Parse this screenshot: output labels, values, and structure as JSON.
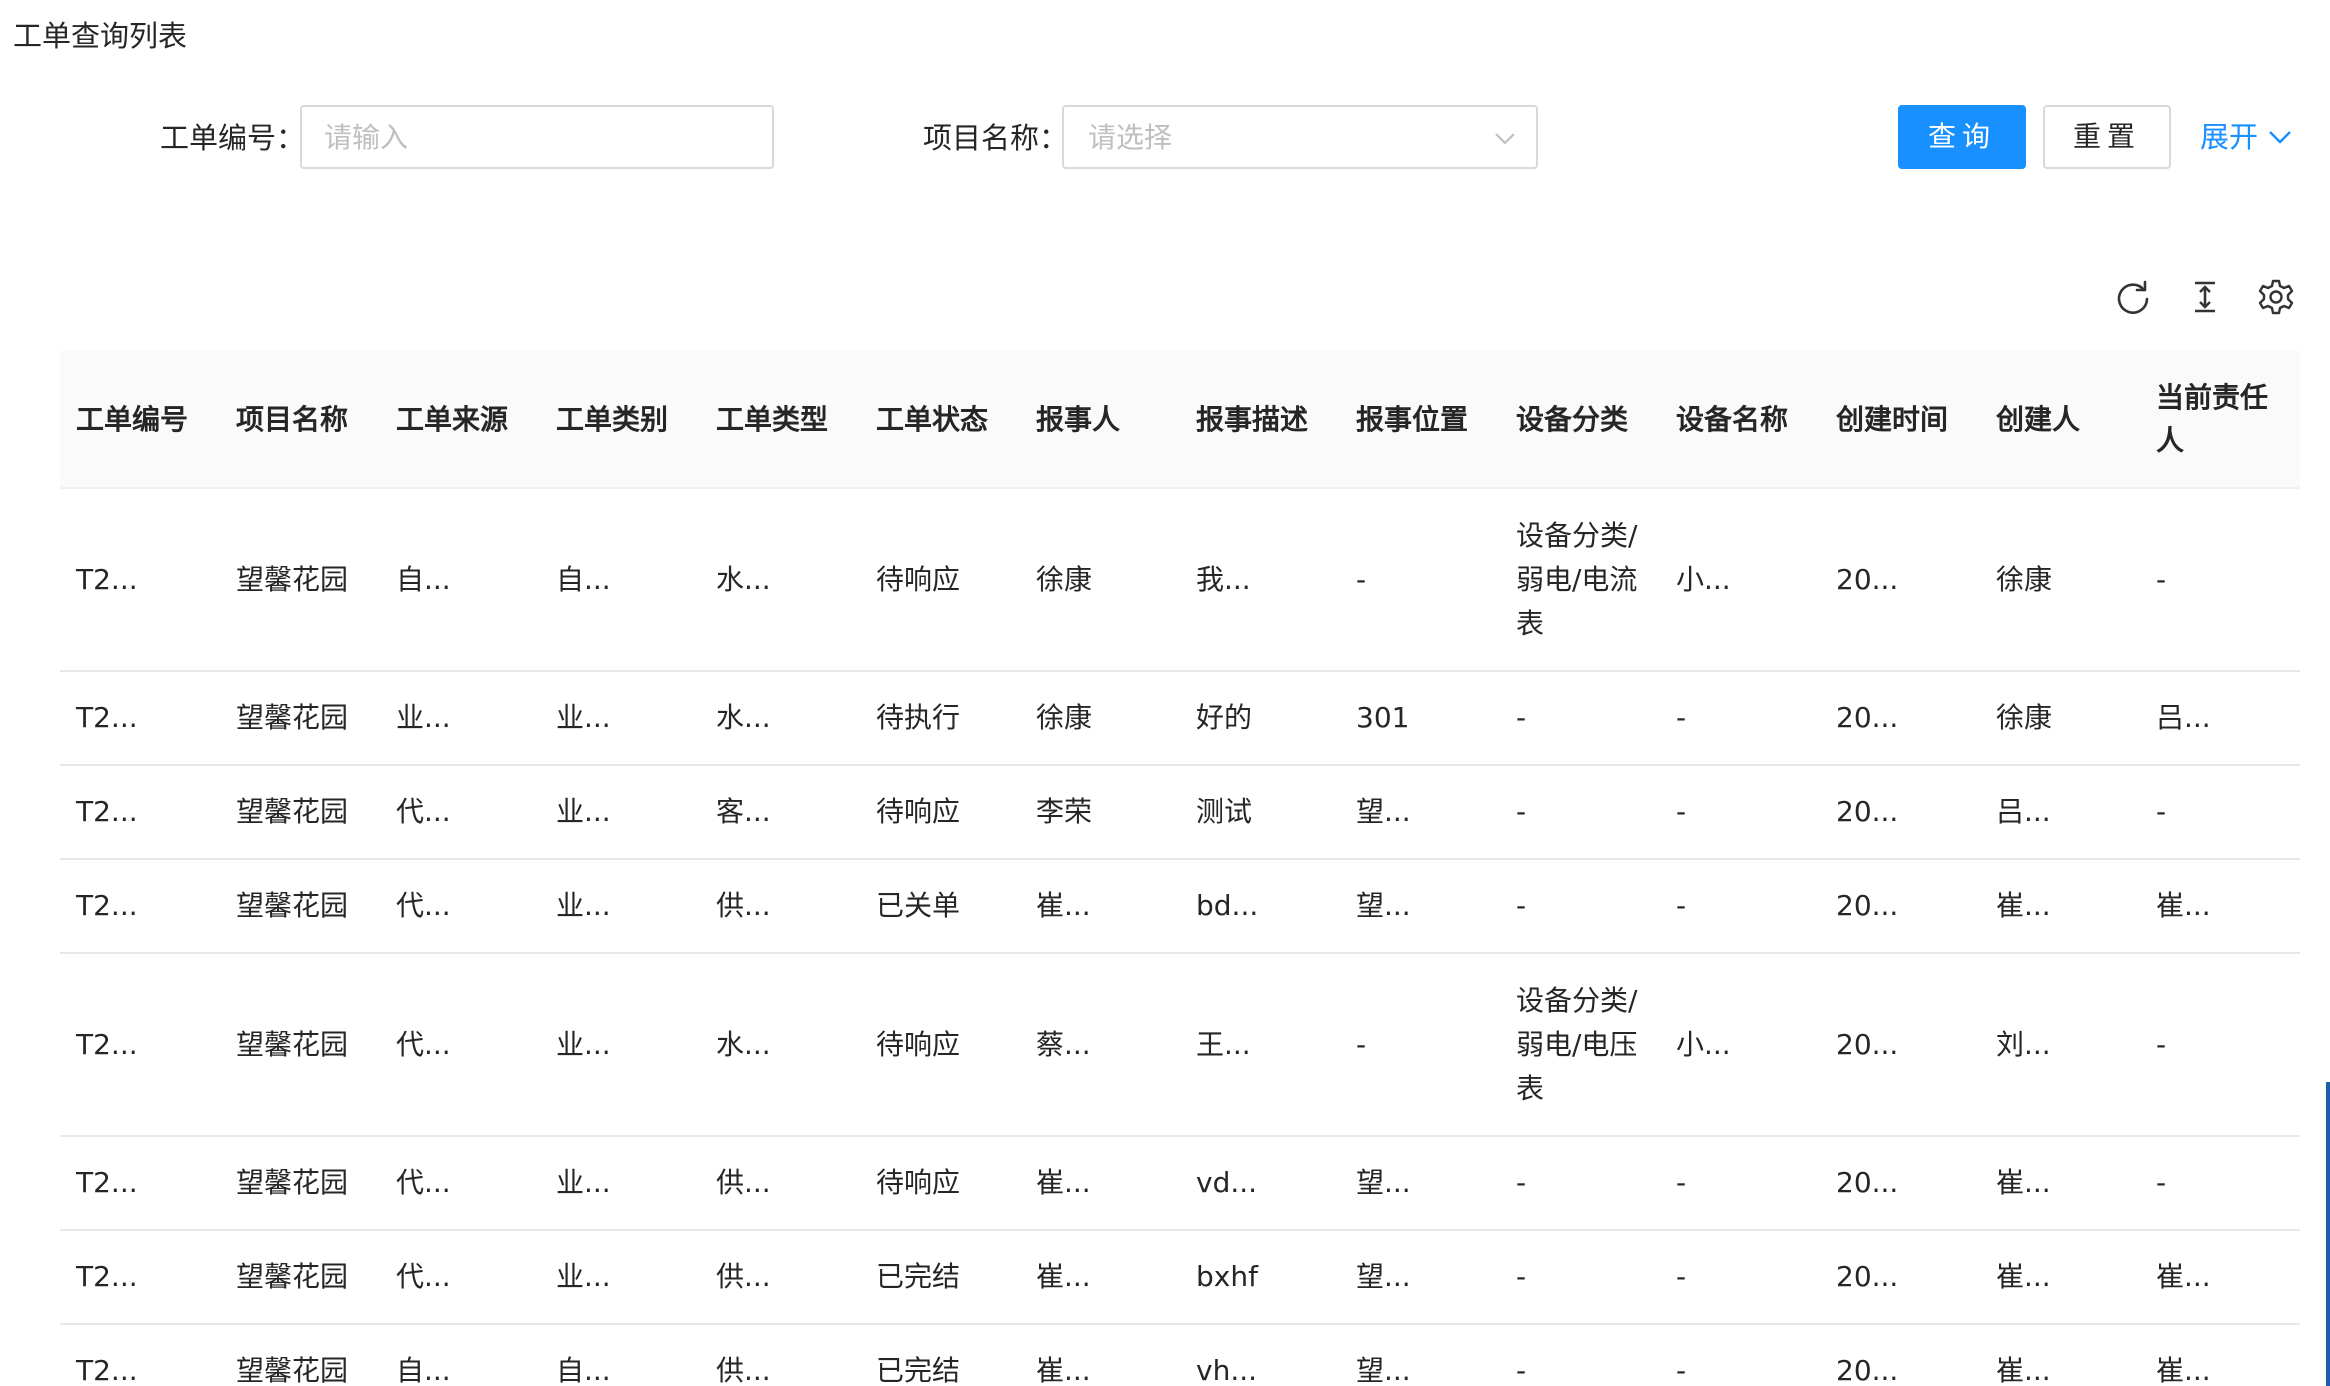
{
  "page": {
    "title": "工单查询列表"
  },
  "search": {
    "order_no_label": "工单编号：",
    "order_no_placeholder": "请输入",
    "project_label": "项目名称：",
    "project_placeholder": "请选择",
    "query_label": "查询",
    "reset_label": "重置",
    "expand_label": "展开"
  },
  "toolbar": {
    "icons": [
      "refresh-icon",
      "column-height-icon",
      "settings-icon"
    ]
  },
  "colors": {
    "primary": "#1890ff",
    "border": "#d9d9d9",
    "header_bg": "#fafafa",
    "placeholder": "#bfbfbf"
  },
  "table": {
    "columns": [
      "工单编号",
      "项目名称",
      "工单来源",
      "工单类别",
      "工单类型",
      "工单状态",
      "报事人",
      "报事描述",
      "报事位置",
      "设备分类",
      "设备名称",
      "创建时间",
      "创建人",
      "当前责任人"
    ],
    "rows": [
      [
        "T2...",
        "望馨花园",
        "自...",
        "自...",
        "水...",
        "待响应",
        "徐康",
        "我...",
        "-",
        "设备分类/弱电/电流表",
        "小...",
        "20...",
        "徐康",
        "-"
      ],
      [
        "T2...",
        "望馨花园",
        "业...",
        "业...",
        "水...",
        "待执行",
        "徐康",
        "好的",
        "301",
        "-",
        "-",
        "20...",
        "徐康",
        "吕..."
      ],
      [
        "T2...",
        "望馨花园",
        "代...",
        "业...",
        "客...",
        "待响应",
        "李荣",
        "测试",
        "望...",
        "-",
        "-",
        "20...",
        "吕...",
        "-"
      ],
      [
        "T2...",
        "望馨花园",
        "代...",
        "业...",
        "供...",
        "已关单",
        "崔...",
        "bd...",
        "望...",
        "-",
        "-",
        "20...",
        "崔...",
        "崔..."
      ],
      [
        "T2...",
        "望馨花园",
        "代...",
        "业...",
        "水...",
        "待响应",
        "蔡...",
        "王...",
        "-",
        "设备分类/弱电/电压表",
        "小...",
        "20...",
        "刘...",
        "-"
      ],
      [
        "T2...",
        "望馨花园",
        "代...",
        "业...",
        "供...",
        "待响应",
        "崔...",
        "vd...",
        "望...",
        "-",
        "-",
        "20...",
        "崔...",
        "-"
      ],
      [
        "T2...",
        "望馨花园",
        "代...",
        "业...",
        "供...",
        "已完结",
        "崔...",
        "bxhf",
        "望...",
        "-",
        "-",
        "20...",
        "崔...",
        "崔..."
      ],
      [
        "T2...",
        "望馨花园",
        "自...",
        "自...",
        "供...",
        "已完结",
        "崔...",
        "vh...",
        "望...",
        "-",
        "-",
        "20...",
        "崔...",
        "崔..."
      ]
    ]
  }
}
